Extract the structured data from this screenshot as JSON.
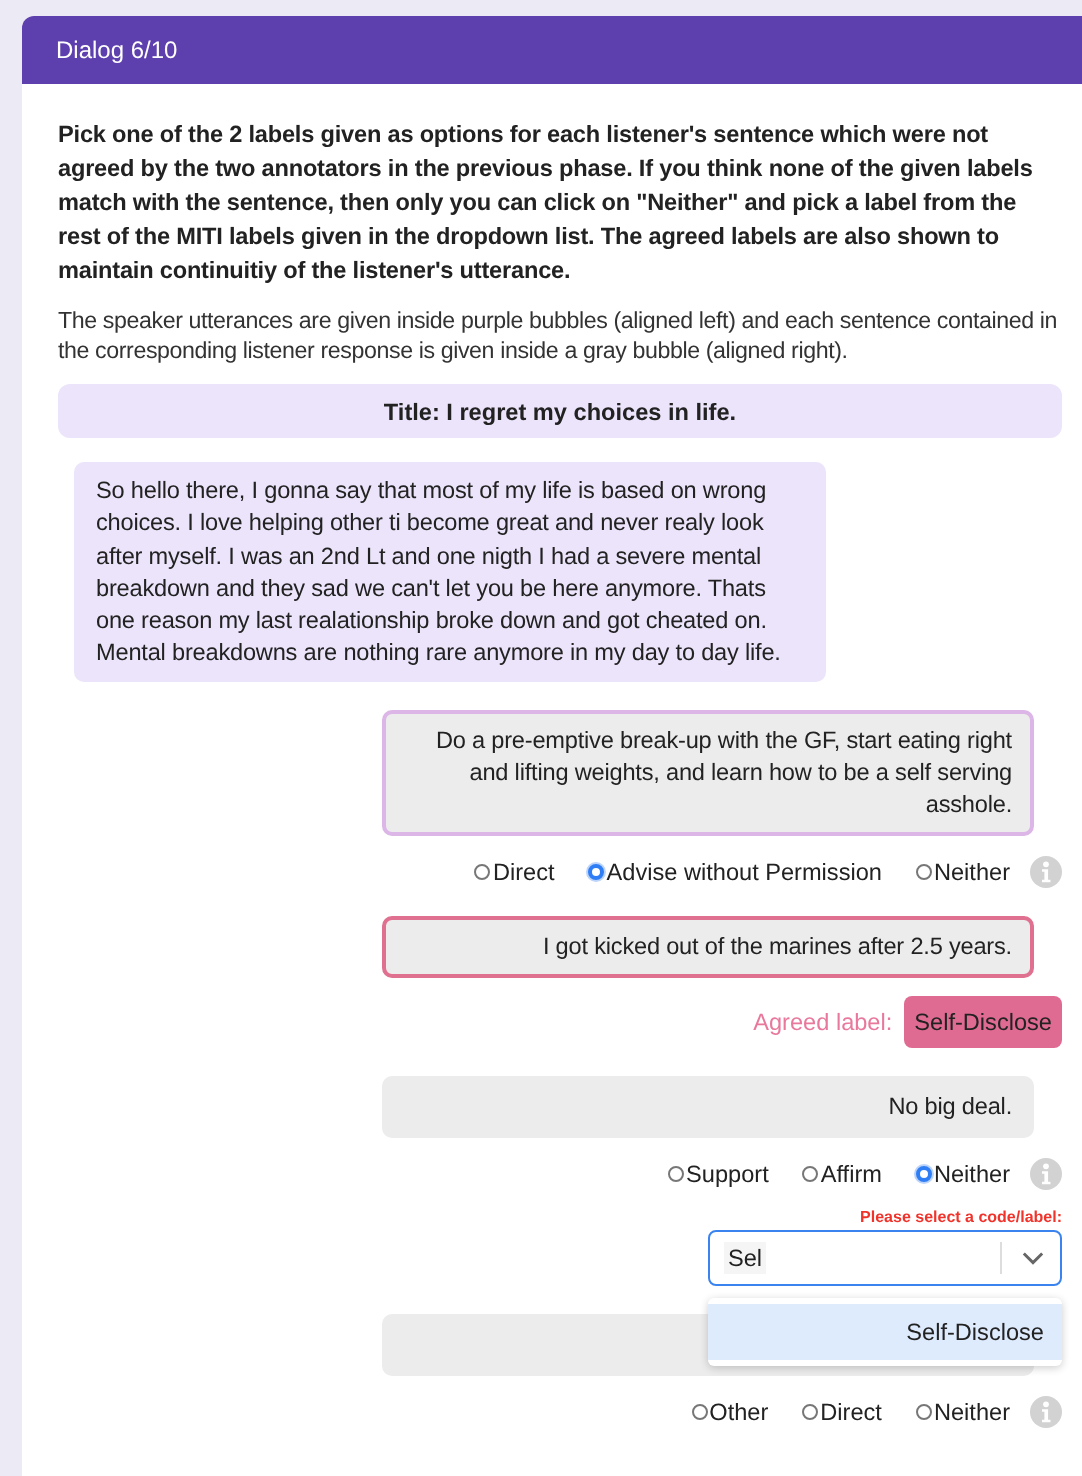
{
  "header": {
    "title": "Dialog 6/10"
  },
  "instructions": "Pick one of the 2 labels given as options for each listener's sentence which were not agreed by the two annotators in the previous phase. If you think none of the given labels match with the sentence, then only you can click on \"Neither\" and pick a label from the rest of the MITI labels given in the dropdown list. The agreed labels are also shown to maintain continuitiy of the listener's utterance.",
  "note": "The speaker utterances are given inside purple bubbles (aligned left) and each sentence contained in the corresponding listener response is given inside a gray bubble (aligned right).",
  "title": "Title: I regret my choices in life.",
  "speaker": "So hello there, I gonna say that most of my life is based on wrong choices. I love helping other ti become great and never realy look after myself. I was an 2nd Lt and one nigth I had a severe mental breakdown and they sad we can't let you be here anymore. Thats one reason my last realationship broke down and got cheated on. Mental breakdowns are nothing rare anymore in my day to day life.",
  "sentences": [
    {
      "kind": "disputed",
      "text": "Do a pre-emptive break-up with the GF, start eating right and lifting weights, and learn how to be a self serving asshole.",
      "color": "#dcb6e6",
      "options": [
        {
          "label": "Direct",
          "selected": false
        },
        {
          "label": "Advise without Permission",
          "selected": true
        },
        {
          "label": "Neither",
          "selected": false
        }
      ]
    },
    {
      "kind": "agreed",
      "text": "I got kicked out of the marines after 2.5 years.",
      "color": "#e0708f",
      "agreed_caption": "Agreed label:",
      "agreed_label": "Self-Disclose"
    },
    {
      "kind": "disputed",
      "text": "No big deal.",
      "options": [
        {
          "label": "Support",
          "selected": false
        },
        {
          "label": "Affirm",
          "selected": false
        },
        {
          "label": "Neither",
          "selected": true
        }
      ],
      "dropdown": {
        "warning": "Please select a code/label:",
        "value": "Sel",
        "menu": [
          "Self-Disclose"
        ]
      }
    },
    {
      "kind": "disputed",
      "options": [
        {
          "label": "Other",
          "selected": false
        },
        {
          "label": "Direct",
          "selected": false
        },
        {
          "label": "Neither",
          "selected": false
        }
      ]
    }
  ]
}
